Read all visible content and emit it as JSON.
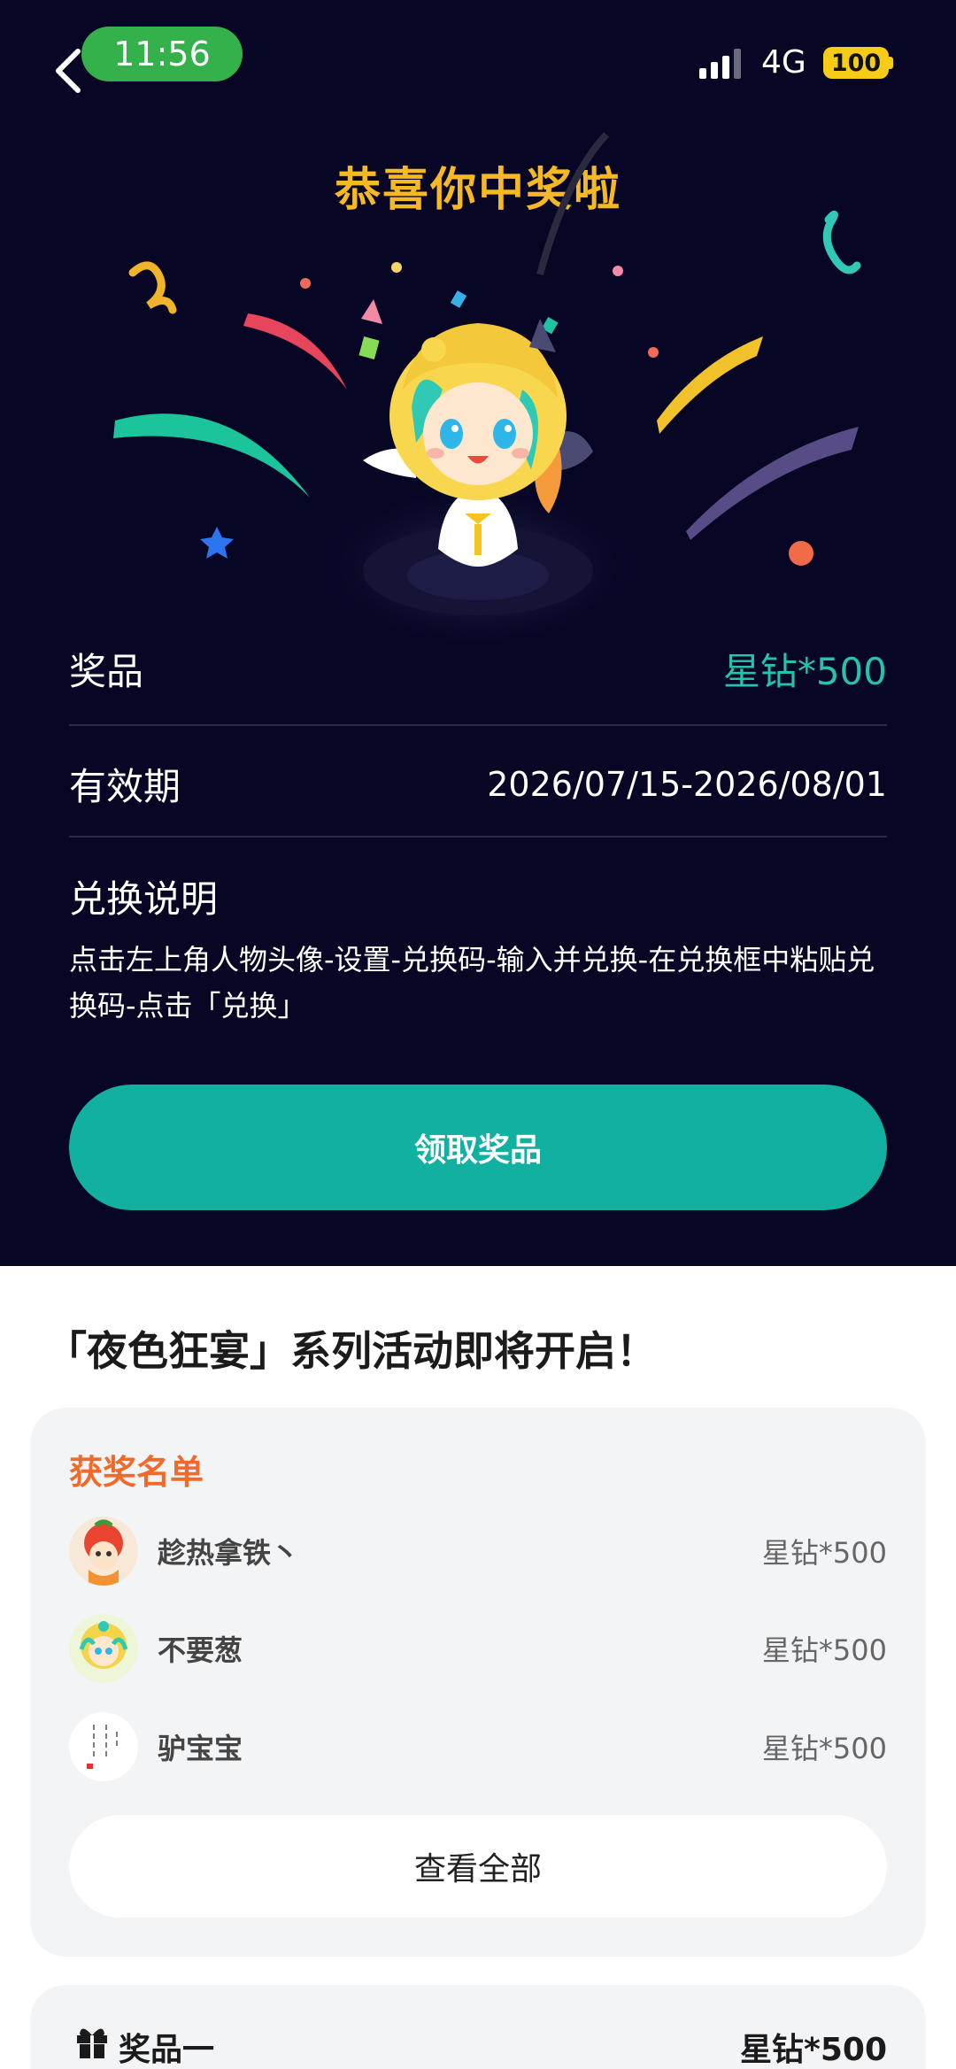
{
  "status_bar": {
    "time": "11:56",
    "network": "4G",
    "battery": "100"
  },
  "hero": {
    "title": "恭喜你中奖啦"
  },
  "info": {
    "prize_label": "奖品",
    "prize_value": "星钻*500",
    "validity_label": "有效期",
    "validity_value": "2026/07/15-2026/08/01",
    "redeem_label": "兑换说明",
    "redeem_desc": "点击左上角人物头像-设置-兑换码-输入并兑换-在兑换框中粘贴兑换码-点击「兑换」"
  },
  "claim_button": "领取奖品",
  "event": {
    "title": "「夜色狂宴」系列活动即将开启！"
  },
  "winners": {
    "heading": "获奖名单",
    "items": [
      {
        "name": "趁热拿铁丶",
        "prize": "星钻*500"
      },
      {
        "name": "不要葱",
        "prize": "星钻*500"
      },
      {
        "name": "驴宝宝",
        "prize": "星钻*500"
      }
    ],
    "view_all": "查看全部"
  },
  "prize_card": {
    "label": "奖品一",
    "value": "星钻*500"
  },
  "colors": {
    "hero_bg": "#070625",
    "accent_teal": "#12b0a0",
    "title_gold": "#f6b924",
    "winners_orange": "#f06a2c"
  }
}
